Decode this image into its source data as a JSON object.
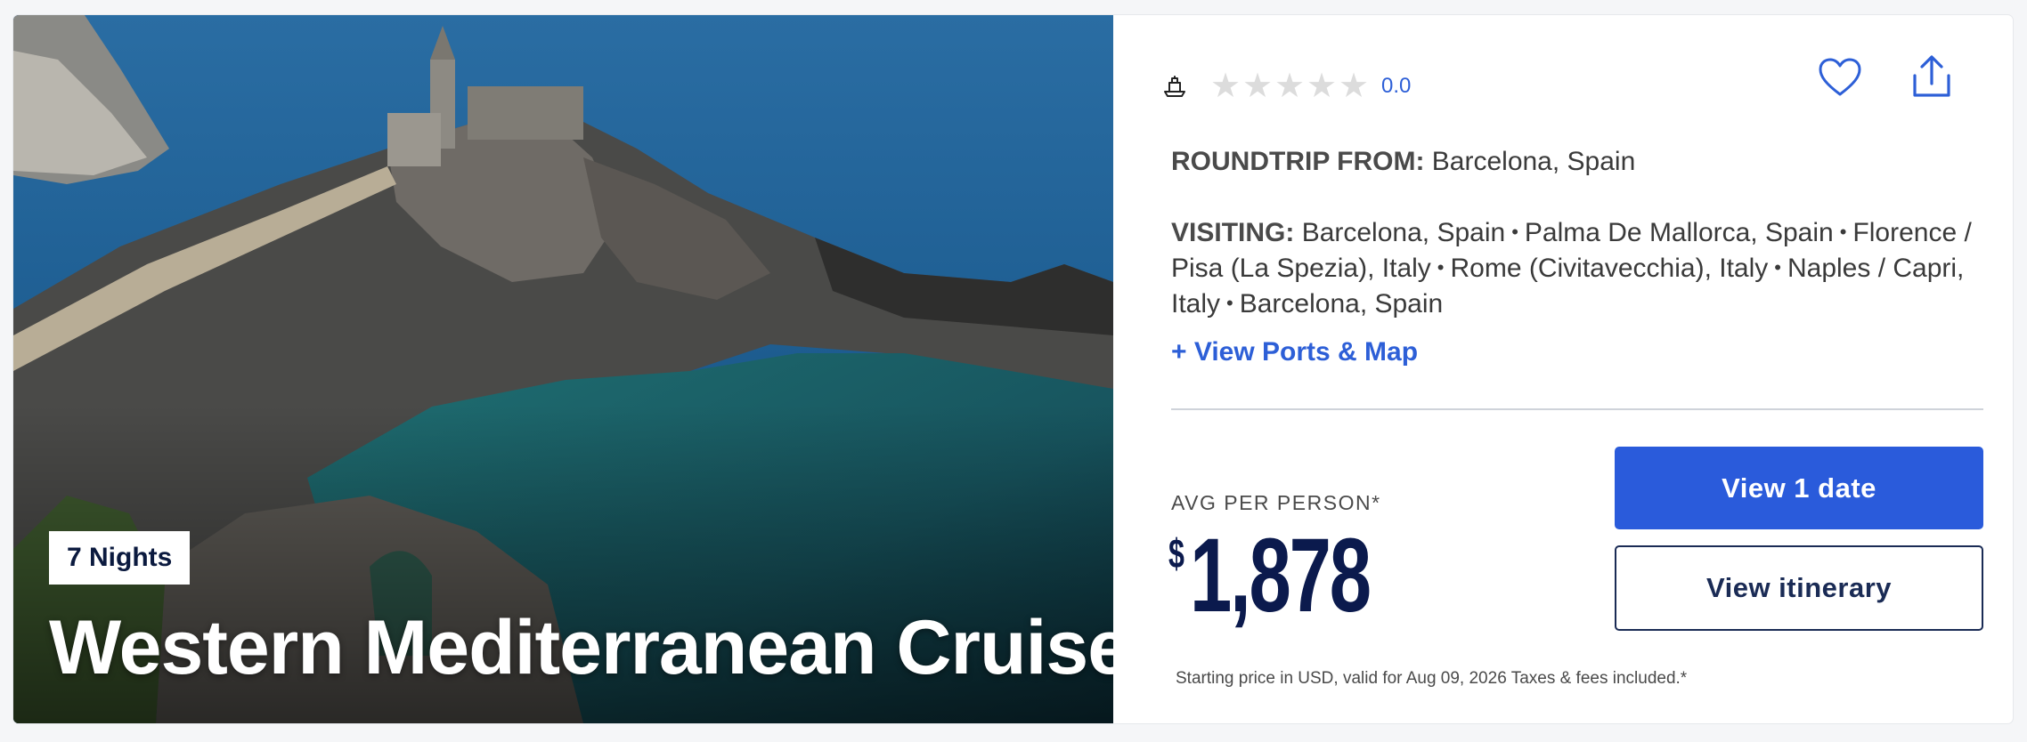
{
  "hero": {
    "image_alt": "Coastal cliff with stone church overlooking the sea",
    "nights_badge": "7 Nights",
    "title": "Western Mediterranean Cruise"
  },
  "rating": {
    "ship_icon": "ship-icon",
    "stars_filled": 0,
    "stars_total": 5,
    "value": "0.0"
  },
  "actions": {
    "favorite_icon": "heart-icon",
    "share_icon": "share-icon"
  },
  "roundtrip": {
    "label": "ROUNDTRIP FROM:",
    "value": "Barcelona, Spain"
  },
  "visiting": {
    "label": "VISITING:",
    "ports": [
      "Barcelona, Spain",
      "Palma De Mallorca, Spain",
      "Florence / Pisa (La Spezia), Italy",
      "Rome (Civitavecchia), Italy",
      "Naples / Capri, Italy",
      "Barcelona, Spain"
    ]
  },
  "view_ports_link": "+ View Ports & Map",
  "pricing": {
    "avg_label": "AVG PER PERSON*",
    "currency_symbol": "$",
    "amount": "1,878",
    "view_dates_button": "View 1 date",
    "view_itinerary_button": "View itinerary",
    "disclaimer": "Starting price in USD, valid for Aug 09, 2026 Taxes & fees included.*"
  },
  "colors": {
    "accent_blue": "#2a5bdb",
    "link_blue": "#2d5fd7",
    "navy": "#0b1a4d",
    "star_empty": "#dcdcdc"
  }
}
